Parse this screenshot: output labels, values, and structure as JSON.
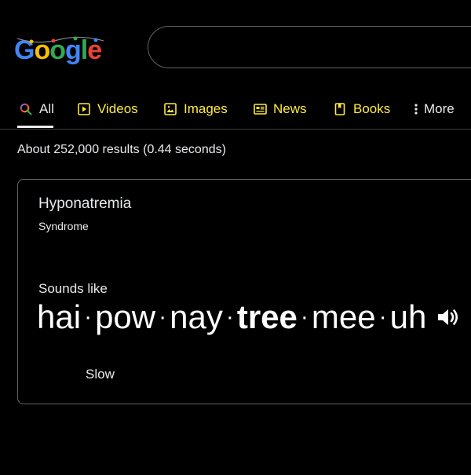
{
  "logo": {
    "letters": [
      "G",
      "o",
      "o",
      "g",
      "l",
      "e"
    ],
    "colors": [
      "#4285f4",
      "#fbbc05",
      "#34a853",
      "#4285f4",
      "#34a853",
      "#ea4335"
    ]
  },
  "search": {
    "value": "",
    "placeholder": ""
  },
  "tabs": [
    {
      "label": "All",
      "icon": "search-icon",
      "active": true
    },
    {
      "label": "Videos",
      "icon": "play-icon"
    },
    {
      "label": "Images",
      "icon": "image-icon"
    },
    {
      "label": "News",
      "icon": "newspaper-icon"
    },
    {
      "label": "Books",
      "icon": "book-icon"
    },
    {
      "label": "More",
      "icon": "more-vertical-icon"
    }
  ],
  "result_stats": "About 252,000 results (0.44 seconds)",
  "pronunciation": {
    "word": "Hyponatremia",
    "part_of_speech": "Syndrome",
    "sounds_like_label": "Sounds like",
    "syllables": [
      "hai",
      "pow",
      "nay",
      "tree",
      "mee",
      "uh"
    ],
    "stressed_syllable": "tree",
    "separator": "·",
    "speaker_icon": "speaker-icon",
    "slow_label": "Slow"
  },
  "colors": {
    "background": "#000000",
    "tab_accent": "#ffeb3b",
    "text": "#e8eaed",
    "border": "#5f6368"
  }
}
